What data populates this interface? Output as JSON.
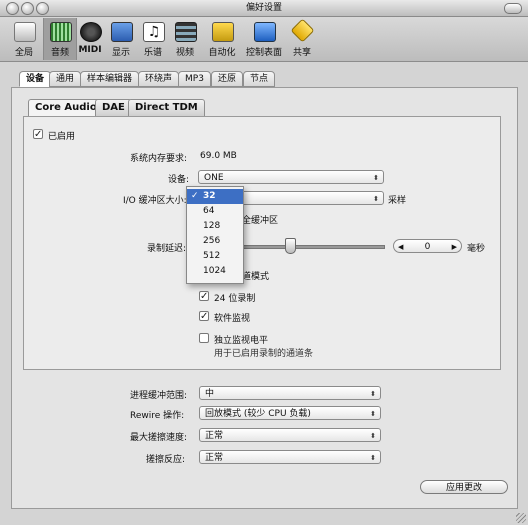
{
  "window": {
    "title": "偏好设置"
  },
  "toolbar": {
    "items": [
      {
        "label": "全局",
        "icon": "switch-icon"
      },
      {
        "label": "音频",
        "icon": "audio-icon"
      },
      {
        "label": "MIDI",
        "icon": "midi-icon"
      },
      {
        "label": "显示",
        "icon": "display-icon"
      },
      {
        "label": "乐谱",
        "icon": "score-icon"
      },
      {
        "label": "视频",
        "icon": "video-icon"
      },
      {
        "label": "自动化",
        "icon": "automation-icon"
      },
      {
        "label": "控制表面",
        "icon": "control-surface-icon"
      },
      {
        "label": "共享",
        "icon": "share-icon"
      }
    ],
    "selected": "音频"
  },
  "tabs": [
    "设备",
    "通用",
    "样本编辑器",
    "环绕声",
    "MP3",
    "还原",
    "节点"
  ],
  "subtabs": [
    "Core Audio",
    "DAE",
    "Direct TDM"
  ],
  "core_audio": {
    "enabled_label": "已启用",
    "memory_label": "系统内存要求:",
    "memory_value": "69.0 MB",
    "device_label": "设备:",
    "device_value": "ONE",
    "io_buffer_label": "I/O 缓冲区大小:",
    "io_buffer_suffix": "采样",
    "safe_buffer_label": "全缓冲区",
    "record_delay_label": "录制延迟:",
    "record_delay_value": "0",
    "record_delay_unit": "毫秒",
    "channel_mode_label": "道模式",
    "record_24bit_label": "24 位录制",
    "software_monitor_label": "软件监视",
    "independent_monitor_label": "独立监视电平",
    "independent_monitor_desc": "用于已启用录制的通道条"
  },
  "buffer_menu": {
    "options": [
      "32",
      "64",
      "128",
      "256",
      "512",
      "1024"
    ],
    "selected": "32",
    "checkmark": "✓"
  },
  "bottom": {
    "process_buffer_label": "进程缓冲范围:",
    "process_buffer_value": "中",
    "rewire_label": "Rewire 操作:",
    "rewire_value": "回放模式 (较少 CPU 负载)",
    "max_scrub_label": "最大搓擦速度:",
    "max_scrub_value": "正常",
    "scrub_response_label": "搓擦反应:",
    "scrub_response_value": "正常",
    "apply_button": "应用更改"
  }
}
